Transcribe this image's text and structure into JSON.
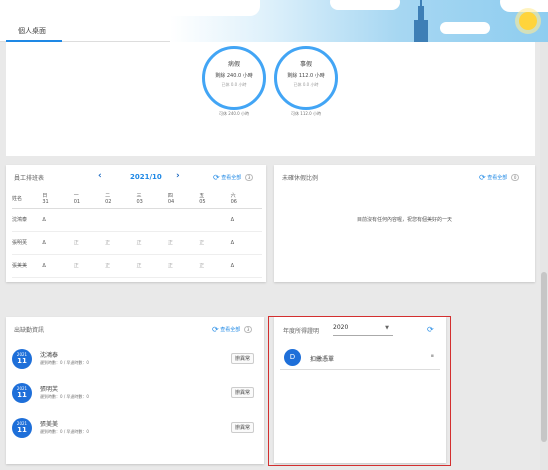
{
  "header": {
    "tab_label": "個人桌面"
  },
  "leave_cards": [
    {
      "title": "病假",
      "total": "剩餘 240.0 小時",
      "used": "已休 0.0 小時",
      "available": "可休 240.0 小時"
    },
    {
      "title": "事假",
      "total": "剩餘 112.0 小時",
      "used": "已休 0.0 小時",
      "available": "可休 112.0 小時"
    }
  ],
  "schedule": {
    "title": "員工排班表",
    "month": "2021/10",
    "refresh_label": "查看全部",
    "refresh_count": "3",
    "header_label": "姓名",
    "days": [
      {
        "w": "日",
        "d": "31"
      },
      {
        "w": "一",
        "d": "01"
      },
      {
        "w": "二",
        "d": "02"
      },
      {
        "w": "三",
        "d": "03"
      },
      {
        "w": "四",
        "d": "04"
      },
      {
        "w": "五",
        "d": "05"
      },
      {
        "w": "六",
        "d": "06"
      }
    ],
    "rows": [
      {
        "name": "沈鴻泰",
        "cells": [
          "Δ",
          "",
          "",
          "",
          "",
          "",
          "Δ"
        ]
      },
      {
        "name": "張明芙",
        "cells": [
          "Δ",
          "正",
          "正",
          "正",
          "正",
          "正",
          "Δ"
        ]
      },
      {
        "name": "張美美",
        "cells": [
          "Δ",
          "正",
          "正",
          "正",
          "正",
          "正",
          "Δ"
        ]
      }
    ]
  },
  "unfinished": {
    "title": "未確休假比例",
    "refresh_label": "查看全部",
    "refresh_count": "0",
    "empty_text": "目前沒有任何內容喔，祝您有個美好的一天"
  },
  "attendance": {
    "title": "出缺勤資訊",
    "refresh_label": "查看全部",
    "refresh_count": "3",
    "items": [
      {
        "year": "2021",
        "day": "11",
        "name": "沈鴻泰",
        "sub": "遲到時數：0 / 早退時數：0",
        "btn": "辦異常"
      },
      {
        "year": "2021",
        "day": "11",
        "name": "張明芙",
        "sub": "遲到時數：0 / 早退時數：0",
        "btn": "辦異常"
      },
      {
        "year": "2021",
        "day": "11",
        "name": "張美美",
        "sub": "遲到時數：0 / 早退時數：0",
        "btn": "辦異常"
      }
    ]
  },
  "tax": {
    "title": "年度所得證明",
    "year": "2020",
    "doc_initial": "D",
    "doc_name": "扣繳憑單"
  }
}
